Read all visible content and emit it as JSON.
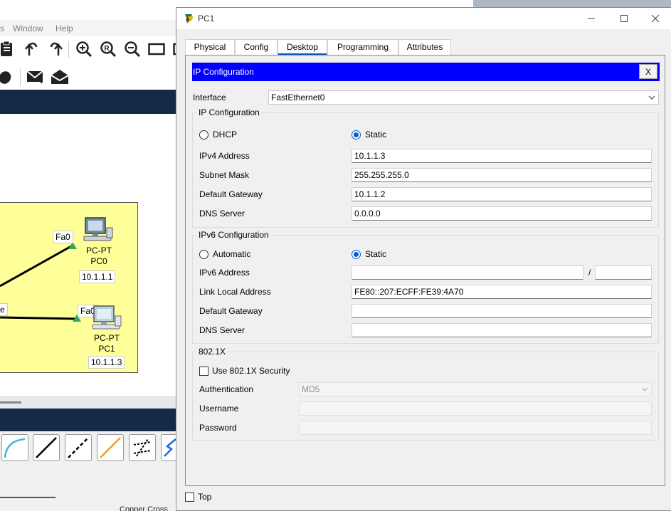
{
  "background_app": {
    "menu": [
      "s",
      "Window",
      "Help"
    ],
    "node_labels": {
      "pc0_port": "Fa0",
      "pc1_port": "Fa0",
      "left_port": "e"
    },
    "devices": [
      {
        "type": "PC-PT",
        "name": "PC0",
        "ip": "10.1.1.1"
      },
      {
        "type": "PC-PT",
        "name": "PC1",
        "ip": "10.1.1.3"
      }
    ],
    "bottom_text": "Copper Cross"
  },
  "window": {
    "title": "PC1",
    "buttons": {
      "minimize": "─",
      "maximize": "☐",
      "close": "✕"
    }
  },
  "tabs": [
    {
      "label": "Physical"
    },
    {
      "label": "Config"
    },
    {
      "label": "Desktop",
      "active": true
    },
    {
      "label": "Programming"
    },
    {
      "label": "Attributes"
    }
  ],
  "ip_config": {
    "header_title": "IP Configuration",
    "close_label": "X",
    "interface_label": "Interface",
    "interface_value": "FastEthernet0",
    "ipv4": {
      "group_title": "IP Configuration",
      "dhcp_label": "DHCP",
      "static_label": "Static",
      "mode": "static",
      "fields": [
        {
          "label": "IPv4 Address",
          "value": "10.1.1.3"
        },
        {
          "label": "Subnet Mask",
          "value": "255.255.255.0"
        },
        {
          "label": "Default Gateway",
          "value": "10.1.1.2"
        },
        {
          "label": "DNS Server",
          "value": "0.0.0.0"
        }
      ]
    },
    "ipv6": {
      "group_title": "IPv6 Configuration",
      "automatic_label": "Automatic",
      "static_label": "Static",
      "mode": "static",
      "address_label": "IPv6 Address",
      "address_value": "",
      "prefix_sep": "/",
      "prefix_value": "",
      "link_local_label": "Link Local Address",
      "link_local_value": "FE80::207:ECFF:FE39:4A70",
      "gateway_label": "Default Gateway",
      "gateway_value": "",
      "dns_label": "DNS Server",
      "dns_value": ""
    },
    "dot1x": {
      "group_title": "802.1X",
      "use_label": "Use 802.1X Security",
      "use_checked": false,
      "auth_label": "Authentication",
      "auth_value": "MD5",
      "username_label": "Username",
      "username_value": "",
      "password_label": "Password",
      "password_value": ""
    }
  },
  "footer": {
    "top_label": "Top",
    "top_checked": false
  },
  "colors": {
    "header_blue": "#0000ff",
    "accent": "#0a55c8",
    "navy": "#142a47",
    "topology_yellow": "#ffff99"
  }
}
